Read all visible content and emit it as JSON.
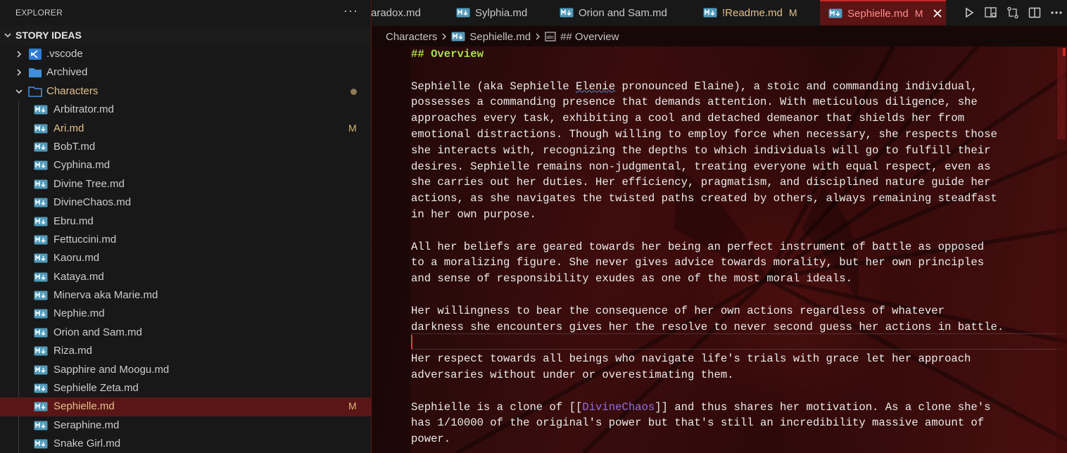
{
  "explorer": {
    "title": "EXPLORER",
    "more_label": "···",
    "workspace": "STORY IDEAS",
    "folders": [
      {
        "label": ".vscode"
      },
      {
        "label": "Archived"
      },
      {
        "label": "Characters"
      }
    ],
    "files": [
      {
        "label": "Arbitrator.md",
        "badge": ""
      },
      {
        "label": "Ari.md",
        "badge": "M"
      },
      {
        "label": "BobT.md",
        "badge": ""
      },
      {
        "label": "Cyphina.md",
        "badge": ""
      },
      {
        "label": "Divine Tree.md",
        "badge": ""
      },
      {
        "label": "DivineChaos.md",
        "badge": ""
      },
      {
        "label": "Ebru.md",
        "badge": ""
      },
      {
        "label": "Fettuccini.md",
        "badge": ""
      },
      {
        "label": "Kaoru.md",
        "badge": ""
      },
      {
        "label": "Kataya.md",
        "badge": ""
      },
      {
        "label": "Minerva aka Marie.md",
        "badge": ""
      },
      {
        "label": "Nephie.md",
        "badge": ""
      },
      {
        "label": "Orion and Sam.md",
        "badge": ""
      },
      {
        "label": "Riza.md",
        "badge": ""
      },
      {
        "label": "Sapphire and Moogu.md",
        "badge": ""
      },
      {
        "label": "Sephielle Zeta.md",
        "badge": ""
      },
      {
        "label": "Sephielle.md",
        "badge": "M"
      },
      {
        "label": "Seraphine.md",
        "badge": ""
      },
      {
        "label": "Snake Girl.md",
        "badge": ""
      }
    ]
  },
  "tabs": [
    {
      "label": "aradox.md",
      "badge": ""
    },
    {
      "label": "Sylphia.md",
      "badge": ""
    },
    {
      "label": "Orion and Sam.md",
      "badge": ""
    },
    {
      "label": "!Readme.md",
      "badge": "M"
    },
    {
      "label": "Sephielle.md",
      "badge": "M"
    }
  ],
  "breadcrumb": {
    "folder": "Characters",
    "file": "Sephielle.md",
    "symbol": "## Overview"
  },
  "editor": {
    "lines": [
      {
        "segments": [
          {
            "text": "## Overview",
            "style": "h"
          }
        ]
      },
      {
        "segments": [
          {
            "text": "",
            "style": ""
          }
        ]
      },
      {
        "segments": [
          {
            "text": "Sephielle (aka Sephielle ",
            "style": ""
          },
          {
            "text": "Elenie",
            "style": "sq"
          },
          {
            "text": " pronounced Elaine), a stoic and commanding individual,",
            "style": ""
          }
        ]
      },
      {
        "segments": [
          {
            "text": "possesses a commanding presence that demands attention. With meticulous diligence, she",
            "style": ""
          }
        ]
      },
      {
        "segments": [
          {
            "text": "approaches every task, exhibiting a cool and detached demeanor that shields her from",
            "style": ""
          }
        ]
      },
      {
        "segments": [
          {
            "text": "emotional distractions. Though willing to employ force when necessary, she respects those",
            "style": ""
          }
        ]
      },
      {
        "segments": [
          {
            "text": "she interacts with, recognizing the depths to which individuals will go to fulfill their",
            "style": ""
          }
        ]
      },
      {
        "segments": [
          {
            "text": "desires. Sephielle remains non-judgmental, treating everyone with equal respect, even as",
            "style": ""
          }
        ]
      },
      {
        "segments": [
          {
            "text": "she carries out her duties. Her efficiency, pragmatism, and disciplined nature guide her",
            "style": ""
          }
        ]
      },
      {
        "segments": [
          {
            "text": "actions, as she navigates the twisted paths created by others, always remaining steadfast",
            "style": ""
          }
        ]
      },
      {
        "segments": [
          {
            "text": "in her own purpose.",
            "style": ""
          }
        ]
      },
      {
        "segments": [
          {
            "text": "",
            "style": ""
          }
        ]
      },
      {
        "segments": [
          {
            "text": "All her beliefs are geared towards her being an perfect instrument of battle as opposed",
            "style": ""
          }
        ]
      },
      {
        "segments": [
          {
            "text": "to a moralizing figure. She never gives advice towards morality, but her own principles",
            "style": ""
          }
        ]
      },
      {
        "segments": [
          {
            "text": "and sense of responsibility exudes as one of the most moral ideals.",
            "style": ""
          }
        ]
      },
      {
        "segments": [
          {
            "text": "",
            "style": ""
          }
        ]
      },
      {
        "segments": [
          {
            "text": "Her willingness to bear the consequence of her own actions regardless of whatever",
            "style": ""
          }
        ]
      },
      {
        "segments": [
          {
            "text": "darkness she encounters gives her the resolve to never second guess her actions in battle.",
            "style": ""
          }
        ]
      },
      {
        "segments": [
          {
            "text": "",
            "style": ""
          }
        ]
      },
      {
        "segments": [
          {
            "text": "Her respect towards all beings who navigate life's trials with grace let her approach",
            "style": ""
          }
        ]
      },
      {
        "segments": [
          {
            "text": "adversaries without under or overestimating them.",
            "style": ""
          }
        ]
      },
      {
        "segments": [
          {
            "text": "",
            "style": ""
          }
        ]
      },
      {
        "segments": [
          {
            "text": "Sephielle is a clone of [[",
            "style": ""
          },
          {
            "text": "DivineChaos",
            "style": "lnk"
          },
          {
            "text": "]] and thus shares her motivation. As a clone she's",
            "style": ""
          }
        ]
      },
      {
        "segments": [
          {
            "text": "has 1/10000 of the original's power but that's still an incredibility massive amount of",
            "style": ""
          }
        ]
      },
      {
        "segments": [
          {
            "text": "power.",
            "style": ""
          }
        ]
      }
    ]
  },
  "colors": {
    "accent": "#c62828",
    "modified": "#e2c08d",
    "heading": "#a8e04b",
    "link": "#8f6fe0",
    "md_icon": "#519aba"
  },
  "icons": {
    "markdown": "markdown-icon",
    "folder": "folder-icon",
    "vscode": "vscode-folder-icon"
  }
}
